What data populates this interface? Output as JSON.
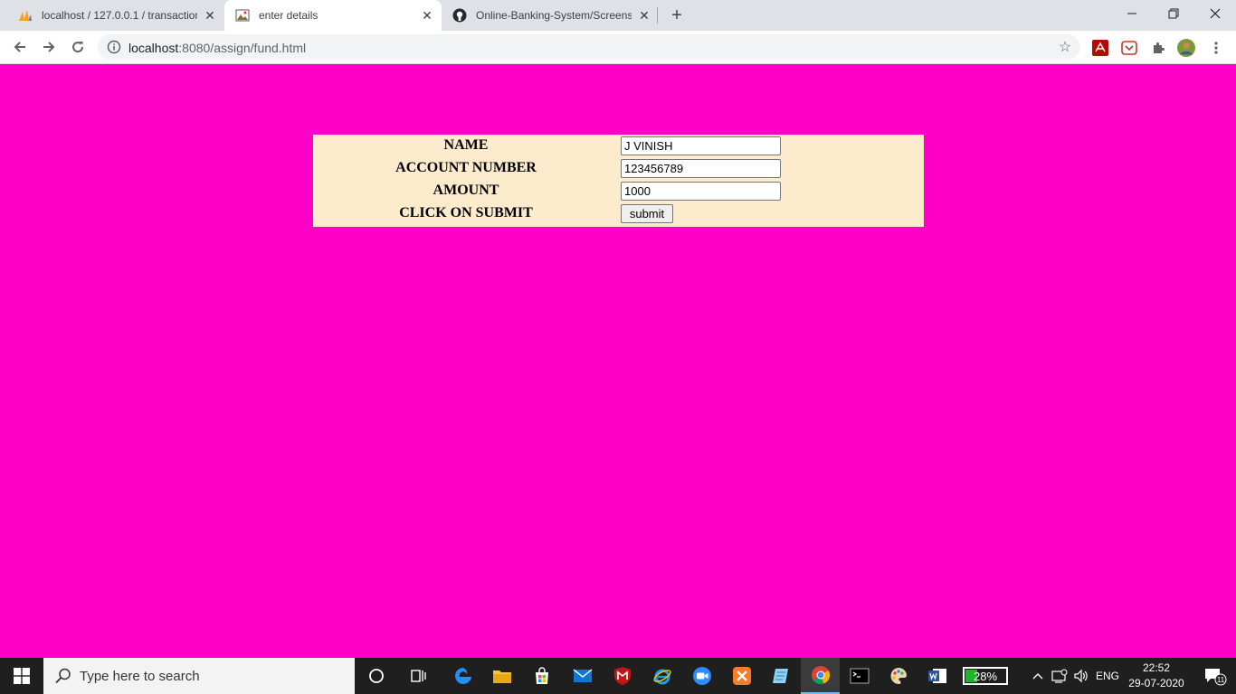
{
  "browser": {
    "tabs": [
      {
        "title": "localhost / 127.0.0.1 / transaction",
        "favicon": "phpmyadmin-icon",
        "active": false
      },
      {
        "title": "enter details",
        "favicon": "page-image-icon",
        "active": true
      },
      {
        "title": "Online-Banking-System/Screensh",
        "favicon": "github-icon",
        "active": false
      }
    ],
    "new_tab_label": "+",
    "url_host": "localhost",
    "url_path": ":8080/assign/fund.html"
  },
  "form": {
    "rows": [
      {
        "label": "NAME",
        "value": "J VINISH"
      },
      {
        "label": "ACCOUNT NUMBER",
        "value": "123456789"
      },
      {
        "label": "AMOUNT",
        "value": "1000"
      },
      {
        "label": "CLICK ON SUBMIT",
        "button": "submit"
      }
    ]
  },
  "taskbar": {
    "search_placeholder": "Type here to search",
    "battery_percent": "28%",
    "battery_level": 0.28,
    "language": "ENG",
    "time": "22:52",
    "date": "29-07-2020",
    "notification_count": "11"
  },
  "colors": {
    "page_background": "#ff00c8",
    "form_background": "#fdebcd"
  }
}
